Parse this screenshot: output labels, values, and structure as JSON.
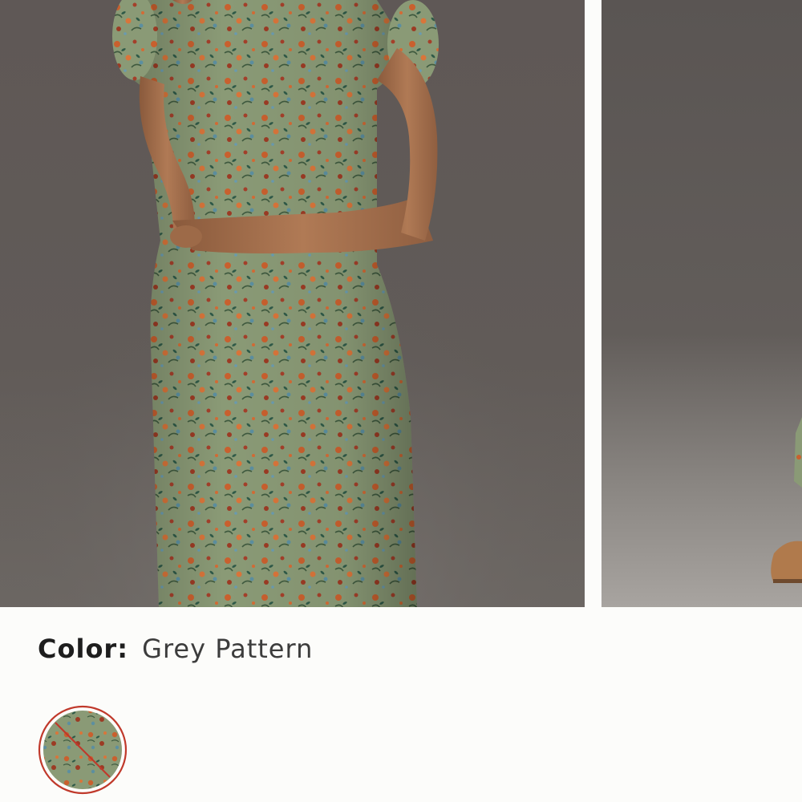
{
  "product": {
    "color_label": "Color:",
    "color_value": "Grey Pattern"
  },
  "gallery": {
    "images": [
      {
        "icon": "model-photo-front",
        "description_name": "dress-front-photo"
      },
      {
        "icon": "model-photo-side",
        "description_name": "dress-side-photo"
      }
    ]
  },
  "swatches": [
    {
      "name": "Grey Pattern",
      "selected": true,
      "available": false,
      "icon": "strikethrough-unavailable"
    }
  ],
  "colors": {
    "background": "#fcfcfa",
    "backdrop": "#5d5856",
    "dress": "#8a9a76",
    "swatch_ring": "#c0392b",
    "strike": "#c0392b"
  }
}
